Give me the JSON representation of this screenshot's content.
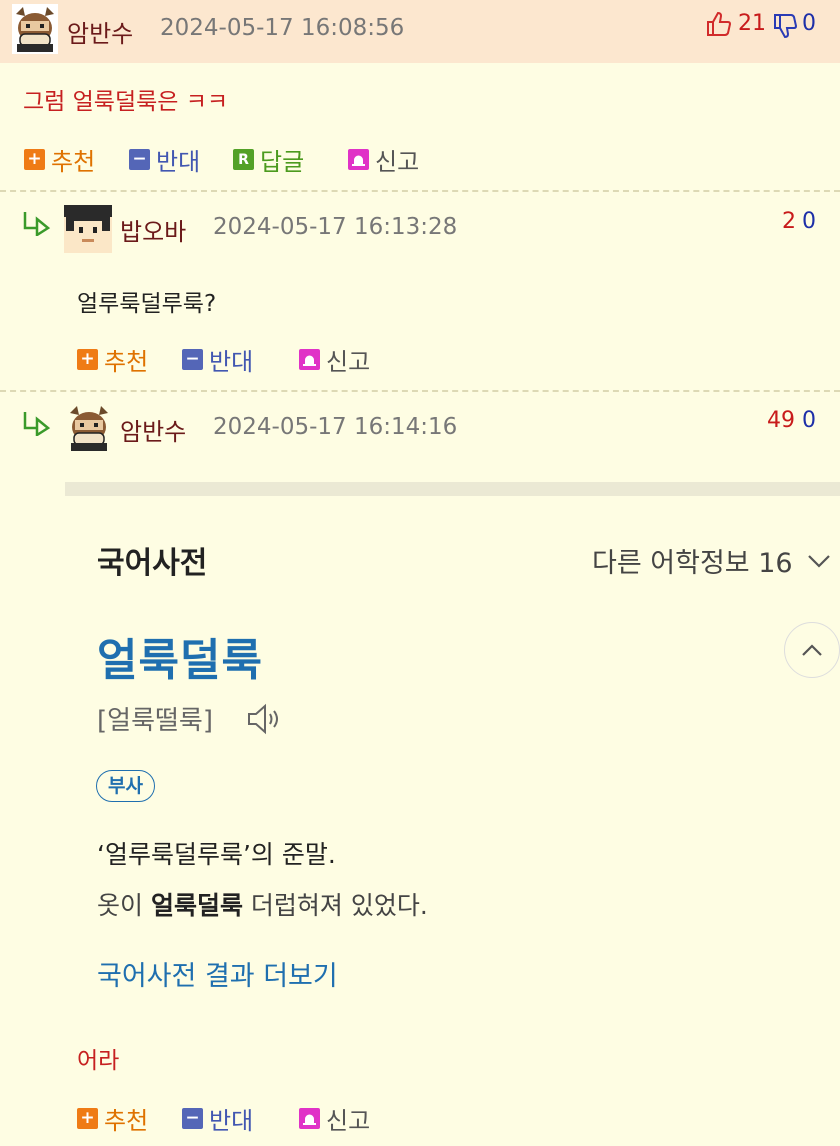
{
  "comments": [
    {
      "nickname": "암반수",
      "date": "2024-05-17 16:08:56",
      "upvotes": "21",
      "downvotes": "0",
      "text": "그럼 얼룩덜룩은 ㅋㅋ",
      "actions": {
        "recommend": "추천",
        "oppose": "반대",
        "reply": "답글",
        "report": "신고"
      }
    },
    {
      "nickname": "밥오바",
      "date": "2024-05-17 16:13:28",
      "upvotes": "2",
      "downvotes": "0",
      "text": "얼루룩덜루룩?",
      "actions": {
        "recommend": "추천",
        "oppose": "반대",
        "report": "신고"
      }
    },
    {
      "nickname": "암반수",
      "date": "2024-05-17 16:14:16",
      "upvotes": "49",
      "downvotes": "0",
      "text": "어라",
      "actions": {
        "recommend": "추천",
        "oppose": "반대",
        "report": "신고"
      }
    }
  ],
  "dictionary": {
    "title": "국어사전",
    "other_info": "다른 어학정보 16",
    "word": "얼룩덜룩",
    "pronunciation": "[얼룩떨룩]",
    "pos": "부사",
    "definition": "‘얼루룩덜루룩’의 준말.",
    "example_pre": "옷이 ",
    "example_bold": "얼룩덜룩",
    "example_post": " 더럽혀져 있었다.",
    "more_link": "국어사전 결과 더보기"
  },
  "colors": {
    "background": "#fefde3",
    "header_bg": "#fce7cf",
    "nickname": "#6b1a1a",
    "up": "#c81b1b",
    "down": "#1d2fa8",
    "dict_link": "#1f6faf"
  }
}
